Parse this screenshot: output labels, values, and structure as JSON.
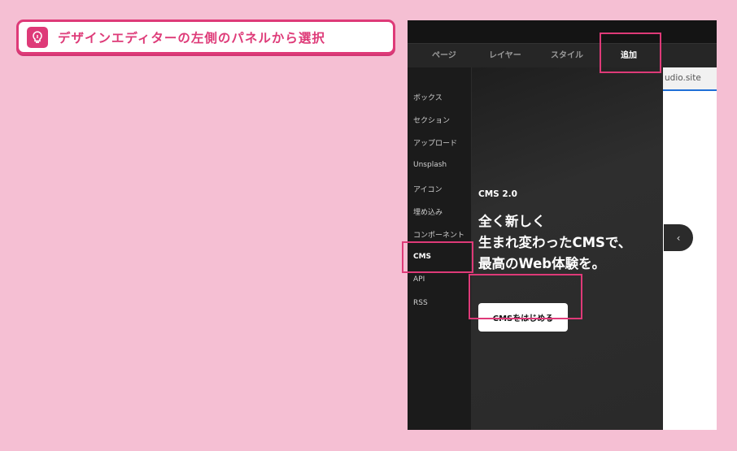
{
  "instruction": {
    "text": "デザインエディターの左側のパネルから選択",
    "icon": "lightbulb-icon",
    "accent": "#de3a78"
  },
  "editor": {
    "tabs": [
      {
        "label": "ページ"
      },
      {
        "label": "レイヤー"
      },
      {
        "label": "スタイル"
      },
      {
        "label": "追加",
        "active": true
      }
    ],
    "sidebar": [
      "ボックス",
      "セクション",
      "アップロード",
      "Unsplash",
      "アイコン",
      "埋め込み",
      "コンポーネント",
      "CMS",
      "API",
      "RSS"
    ],
    "active_sidebar": "CMS",
    "panel": {
      "version": "CMS 2.0",
      "headline": [
        "全く新しく",
        "生まれ変わったCMSで、",
        "最高のWeb体験を。"
      ],
      "cta": "CMSをはじめる"
    },
    "url_fragment": "udio.site",
    "collapse_icon": "chevron-left-icon"
  }
}
